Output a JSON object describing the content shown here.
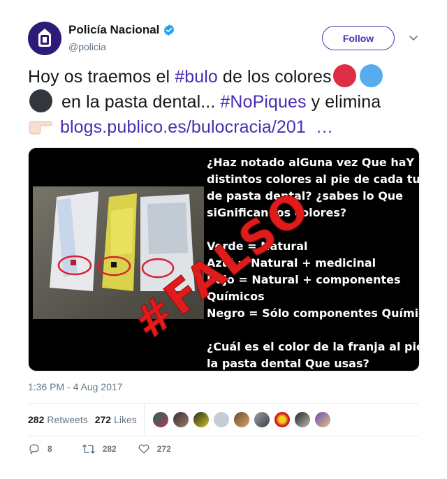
{
  "user": {
    "display_name": "Policía Nacional",
    "handle": "@policia",
    "verified": true,
    "follow_label": "Follow"
  },
  "tweet": {
    "line1_pre": "Hoy os traemos el ",
    "line1_tag": "#bulo",
    "line1_post": " de los colores",
    "line2_pre": " en la pasta dental... ",
    "line2_tag": "#NoPiques",
    "line2_post": " y elimina",
    "link": "blogs.publico.es/bulocracia/201",
    "link_ellipsis": "…",
    "timestamp": "1:36 PM - 4 Aug 2017"
  },
  "media": {
    "lines": [
      "¿Haz notado alGuna vez Que haY",
      "distintos colores al pie de cada tubo",
      "de pasta dental? ¿sabes lo Que",
      "siGnifican los colores?",
      "",
      "Verde = Natural",
      "Azul = Natural + medicinal",
      "Rojo = Natural + componentes",
      "Químicos",
      "Negro = Sólo componentes Químicos",
      "",
      "¿Cuál es el color de la franja al pie de",
      "la pasta dental Que usas?"
    ],
    "stamp": "#FALSO"
  },
  "stats": {
    "retweets_count": "282",
    "retweets_label": "Retweets",
    "likes_count": "272",
    "likes_label": "Likes"
  },
  "actions": {
    "reply_count": "8",
    "retweet_count": "282",
    "like_count": "272"
  },
  "colors": {
    "brand": "#4b2db3",
    "red_dot": "#dd2e44",
    "blue_dot": "#55acee",
    "black_dot": "#31373d",
    "stamp": "#e01b1b"
  },
  "icons": [
    "verified-badge-icon",
    "chevron-down-icon",
    "pointing-hand-icon",
    "reply-icon",
    "retweet-icon",
    "heart-icon"
  ]
}
